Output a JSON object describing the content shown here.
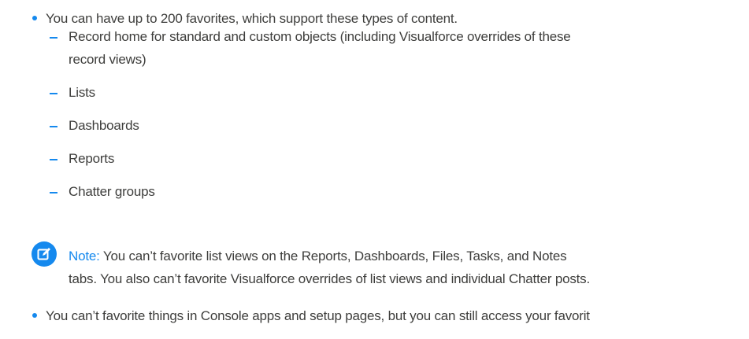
{
  "items": [
    {
      "text": "You can have up to 200 favorites, which support these types of content."
    },
    {
      "subitems": [
        "Record home for standard and custom objects (including Visualforce overrides of these",
        "record views)",
        "Lists",
        "Dashboards",
        "Reports",
        "Chatter groups"
      ]
    },
    {
      "note": {
        "label": "Note:",
        "line1": "You can’t favorite list views on the Reports, Dashboards, Files, Tasks, and Notes",
        "line2": "tabs. You also can’t favorite Visualforce overrides of list views and individual Chatter posts."
      }
    },
    {
      "text": "You can’t favorite things in Console apps and setup pages, but you can still access your favorit"
    }
  ],
  "colors": {
    "accent": "#1589ee",
    "text": "#3e3e3c"
  },
  "icons": {
    "bullet": "bullet-dot",
    "dash": "dash",
    "note": "note-edit-icon"
  }
}
